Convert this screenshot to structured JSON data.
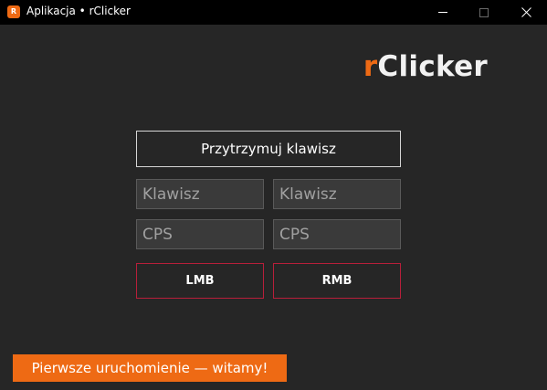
{
  "window": {
    "title": "Aplikacja • rClicker",
    "icon_label": "R",
    "controls": [
      "minimize-icon",
      "maximize-icon",
      "close-icon"
    ]
  },
  "logo": {
    "accent": "r",
    "rest": "Clicker",
    "accent_color": "#ee6a14"
  },
  "main": {
    "hold_button_label": "Przytrzymuj klawisz",
    "left": {
      "key_placeholder": "Klawisz",
      "cps_placeholder": "CPS",
      "button_label": "LMB"
    },
    "right": {
      "key_placeholder": "Klawisz",
      "cps_placeholder": "CPS",
      "button_label": "RMB"
    }
  },
  "banner": {
    "text": "Pierwsze uruchomienie — witamy!",
    "color": "#ee6a14"
  },
  "colors": {
    "background": "#262626",
    "titlebar": "#000000",
    "mouse_button_border": "#b81f3a"
  }
}
